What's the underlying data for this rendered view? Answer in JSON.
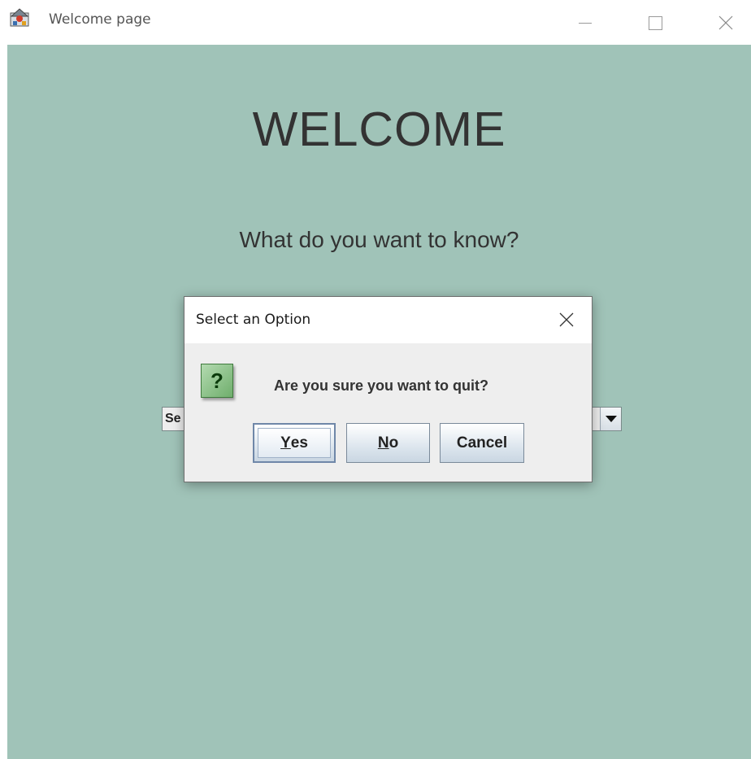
{
  "window": {
    "title": "Welcome page",
    "icon": "java-app-icon",
    "controls": [
      "minimize-icon",
      "maximize-icon",
      "close-icon"
    ]
  },
  "main": {
    "heading": "WELCOME",
    "question": "What do you want to know?",
    "combo_visible_text": "Se"
  },
  "dialog": {
    "title": "Select an Option",
    "icon": "question-icon",
    "icon_glyph": "?",
    "message": "Are you sure you want to quit?",
    "buttons": {
      "yes_mnemonic": "Y",
      "yes_rest": "es",
      "no_mnemonic": "N",
      "no_rest": "o",
      "cancel": "Cancel"
    }
  },
  "colors": {
    "content_bg": "#a0c3b8",
    "dialog_bg": "#eeeeee",
    "text": "#333333"
  }
}
